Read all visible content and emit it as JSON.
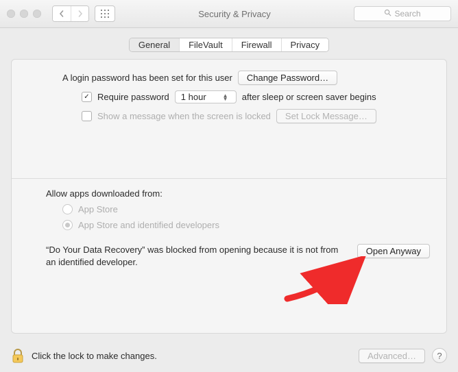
{
  "window": {
    "title": "Security & Privacy",
    "search_placeholder": "Search"
  },
  "tabs": {
    "items": [
      "General",
      "FileVault",
      "Firewall",
      "Privacy"
    ],
    "active_index": 0
  },
  "login": {
    "password_set_text": "A login password has been set for this user",
    "change_password_label": "Change Password…",
    "require_password_label": "Require password",
    "require_password_checked": true,
    "delay_value": "1 hour",
    "after_sleep_text": "after sleep or screen saver begins",
    "show_message_label": "Show a message when the screen is locked",
    "show_message_checked": false,
    "set_lock_message_label": "Set Lock Message…"
  },
  "gatekeeper": {
    "heading": "Allow apps downloaded from:",
    "option_app_store": "App Store",
    "option_identified": "App Store and identified developers",
    "selected_index": 1,
    "blocked_message": "“Do Your Data Recovery” was blocked from opening because it is not from an identified developer.",
    "open_anyway_label": "Open Anyway"
  },
  "footer": {
    "lock_text": "Click the lock to make changes.",
    "advanced_label": "Advanced…",
    "help_label": "?"
  }
}
